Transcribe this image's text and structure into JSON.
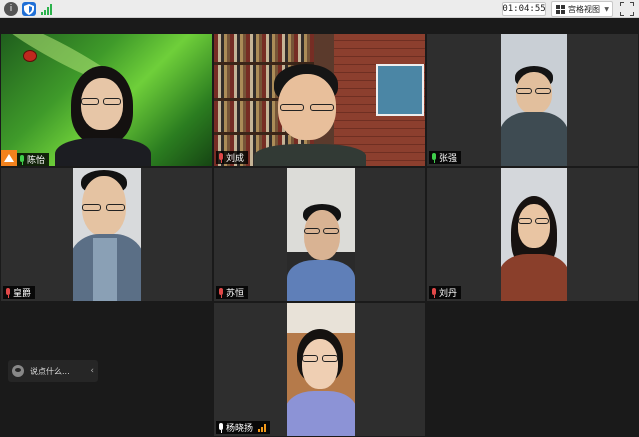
{
  "toolbar": {
    "timer": "01:04:55",
    "view_label": "宫格视图",
    "icons": [
      "info-icon",
      "shield-icon",
      "signal-icon",
      "grid-view-icon",
      "fullscreen-icon"
    ]
  },
  "participants": [
    {
      "name": "陈怡",
      "mic": "active",
      "host": true
    },
    {
      "name": "刘成",
      "mic": "muted"
    },
    {
      "name": "张强",
      "mic": "active"
    },
    {
      "name": "皇爵",
      "mic": "muted"
    },
    {
      "name": "苏恒",
      "mic": "muted"
    },
    {
      "name": "刘丹",
      "mic": "muted"
    },
    {
      "name": "杨晓扬",
      "mic": "white",
      "signal": true
    }
  ],
  "chat": {
    "placeholder": "说点什么..."
  },
  "colors": {
    "muted": "#e04848",
    "active": "#3fcf4b",
    "host": "#f2821d",
    "signal": "#f29a1b"
  }
}
